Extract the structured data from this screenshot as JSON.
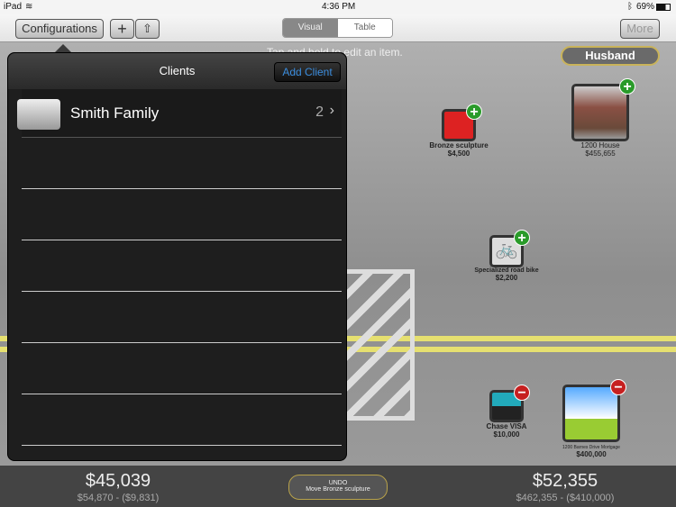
{
  "status": {
    "device": "iPad",
    "time": "4:36 PM",
    "battery": "69%"
  },
  "toolbar": {
    "configurations": "Configurations",
    "plus": "+",
    "more": "More",
    "segments": [
      "Visual",
      "Table"
    ],
    "selected": "Visual"
  },
  "canvas": {
    "hint": "Tap and hold to edit an item.",
    "owner": "Husband",
    "assets": [
      {
        "name": "Bronze sculpture",
        "value": "$4,500",
        "icon": "ring-icon"
      },
      {
        "name": "1200 House",
        "value": "$455,655",
        "icon": "house-photo-icon"
      },
      {
        "name": "Specialized road bike",
        "value": "$2,200",
        "icon": "bicycle-icon"
      }
    ],
    "liabilities": [
      {
        "name": "Chase VISA",
        "value": "$10,000",
        "icon": "credit-card-icon"
      },
      {
        "name": "1200 Barnes Drive Mortgage",
        "value": "$400,000",
        "icon": "bank-icon"
      }
    ]
  },
  "bottom": {
    "left_total": "$45,039",
    "left_detail": "$54,870 - ($9,831)",
    "right_total": "$52,355",
    "right_detail": "$462,355 - ($410,000)",
    "undo_title": "UNDO",
    "undo_action": "Move Bronze sculpture"
  },
  "popover": {
    "title": "Clients",
    "add_button": "Add Client",
    "clients": [
      {
        "name": "Smith Family",
        "count": "2"
      }
    ]
  },
  "colors": {
    "accent": "#3b8dde",
    "road": "#e6e070",
    "plus": "#2a9b2a",
    "minus": "#c62020"
  }
}
